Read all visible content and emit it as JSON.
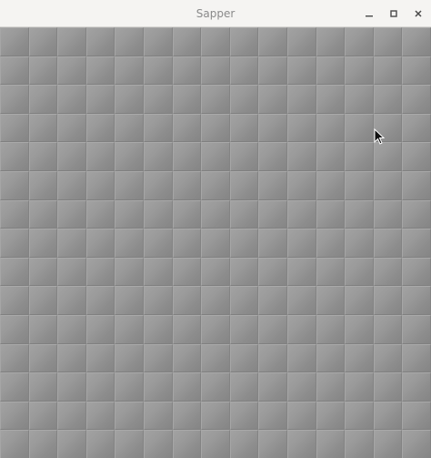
{
  "window": {
    "title": "Sapper",
    "controls": {
      "minimize": "minimize-icon",
      "maximize": "maximize-icon",
      "close": "close-icon"
    }
  },
  "board": {
    "columns": 15,
    "rows": 15,
    "cell_state": "unrevealed",
    "cell_color": "#999999"
  },
  "pointer": {
    "icon": "mouse-pointer-icon"
  }
}
